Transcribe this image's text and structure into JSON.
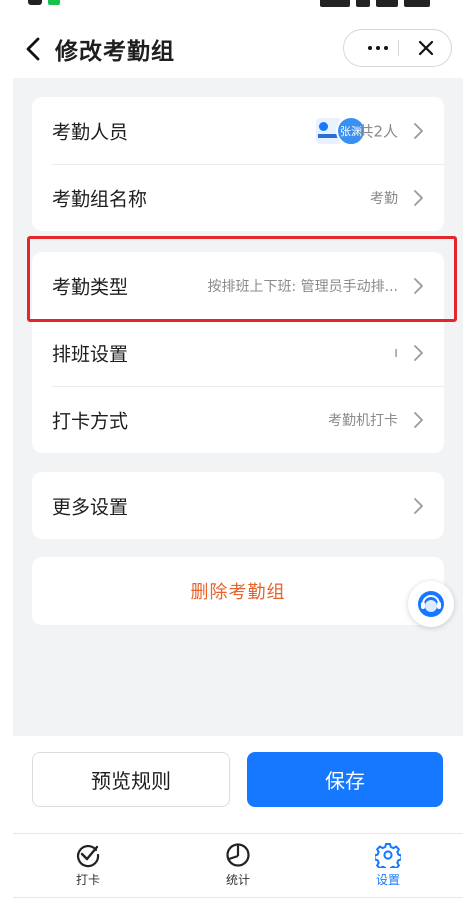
{
  "header": {
    "title": "修改考勤组"
  },
  "rows": {
    "members": {
      "label": "考勤人员",
      "avatar_name": "张渊",
      "count": "共2人"
    },
    "group_name": {
      "label": "考勤组名称",
      "value": "考勤"
    },
    "type": {
      "label": "考勤类型",
      "value": "按排班上下班: 管理员手动排..."
    },
    "schedule": {
      "label": "排班设置",
      "value": "ı"
    },
    "punch_method": {
      "label": "打卡方式",
      "value": "考勤机打卡"
    },
    "more": {
      "label": "更多设置"
    }
  },
  "delete_label": "删除考勤组",
  "buttons": {
    "preview": "预览规则",
    "save": "保存"
  },
  "tabs": [
    {
      "label": "打卡",
      "icon": "check-circle-icon"
    },
    {
      "label": "统计",
      "icon": "pie-chart-icon"
    },
    {
      "label": "设置",
      "icon": "gear-icon",
      "active": true
    }
  ],
  "colors": {
    "accent": "#1677ff",
    "danger_text": "#e8622c",
    "highlight_border": "#e3262b",
    "background": "#f2f3f5"
  }
}
